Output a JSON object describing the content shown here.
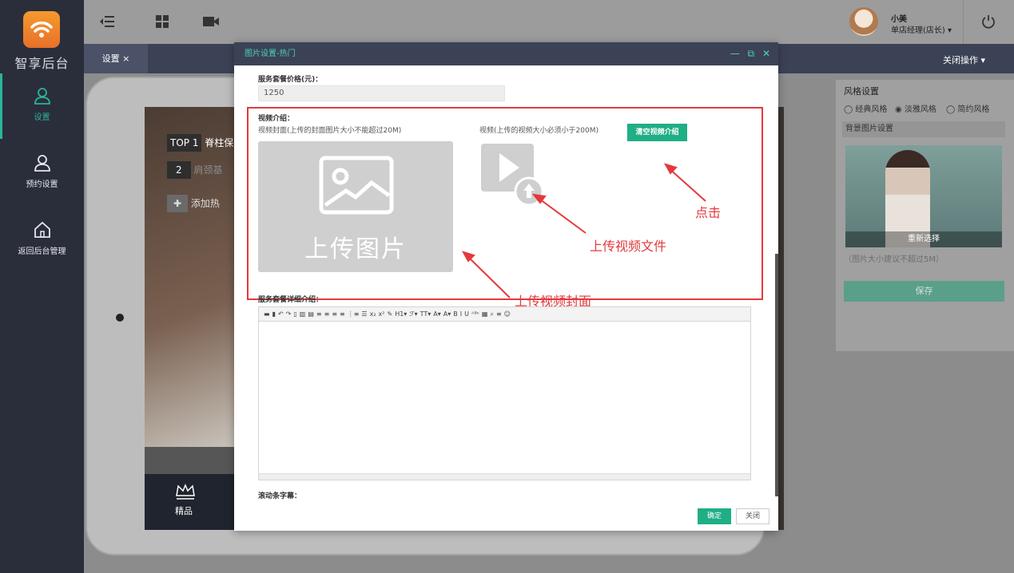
{
  "app": {
    "name": "智享后台"
  },
  "sidebar": {
    "items": [
      {
        "label": "设置"
      },
      {
        "label": "预约设置"
      },
      {
        "label": "返回后台管理"
      }
    ]
  },
  "header": {
    "user_name": "小美",
    "user_role": "单店经理(店长) ▾"
  },
  "tabs": {
    "active": "设置 ×",
    "close_ops": "关闭操作 ▾"
  },
  "preview": {
    "items": [
      {
        "rank": "TOP 1",
        "name": "脊柱保"
      },
      {
        "rank": "2",
        "name": "肩颈基"
      }
    ],
    "add_label": "添加热",
    "footer_label": "精品"
  },
  "style_panel": {
    "title": "风格设置",
    "options": [
      "经典风格",
      "淡雅风格",
      "简约风格"
    ],
    "selected": "淡雅风格",
    "bg_title": "背景图片设置",
    "reselect": "重新选择",
    "size_note": "（图片大小建议不超过5M）",
    "save": "保存"
  },
  "modal": {
    "title": "图片设置-热门",
    "price_label": "服务套餐价格(元)：",
    "price_value": "1250",
    "video_intro_label": "视频介绍：",
    "cover_hint": "视频封面(上传的封面图片大小不能超过20M)",
    "video_hint": "视频(上传的视频大小必须小于200M)",
    "clear_button": "清空视频介绍",
    "upload_image_text": "上传图片",
    "detail_label": "服务套餐详细介绍：",
    "marquee_label": "滚动条字幕：",
    "ok": "确定",
    "close": "关闭"
  },
  "annotations": {
    "click": "点击",
    "upload_video": "上传视频文件",
    "upload_cover": "上传视频封面"
  },
  "editor_tools": [
    "▬",
    "▮",
    "↶",
    "↷",
    "▯",
    "▥",
    "▤",
    "≡",
    "≡",
    "≡",
    "≡",
    "⋮≡",
    "☰",
    "x₂",
    "x²",
    "✎",
    "H1▾",
    "ℱ▾",
    "TT▾",
    "A▾",
    "A▾",
    "B",
    "I",
    "U",
    "ᴬᴮᶜ",
    "▦",
    "⌕",
    "≡",
    "☺"
  ],
  "colors": {
    "accent": "#1fae86",
    "annotation": "#e4393c",
    "sidebar": "#2a2e3b"
  }
}
